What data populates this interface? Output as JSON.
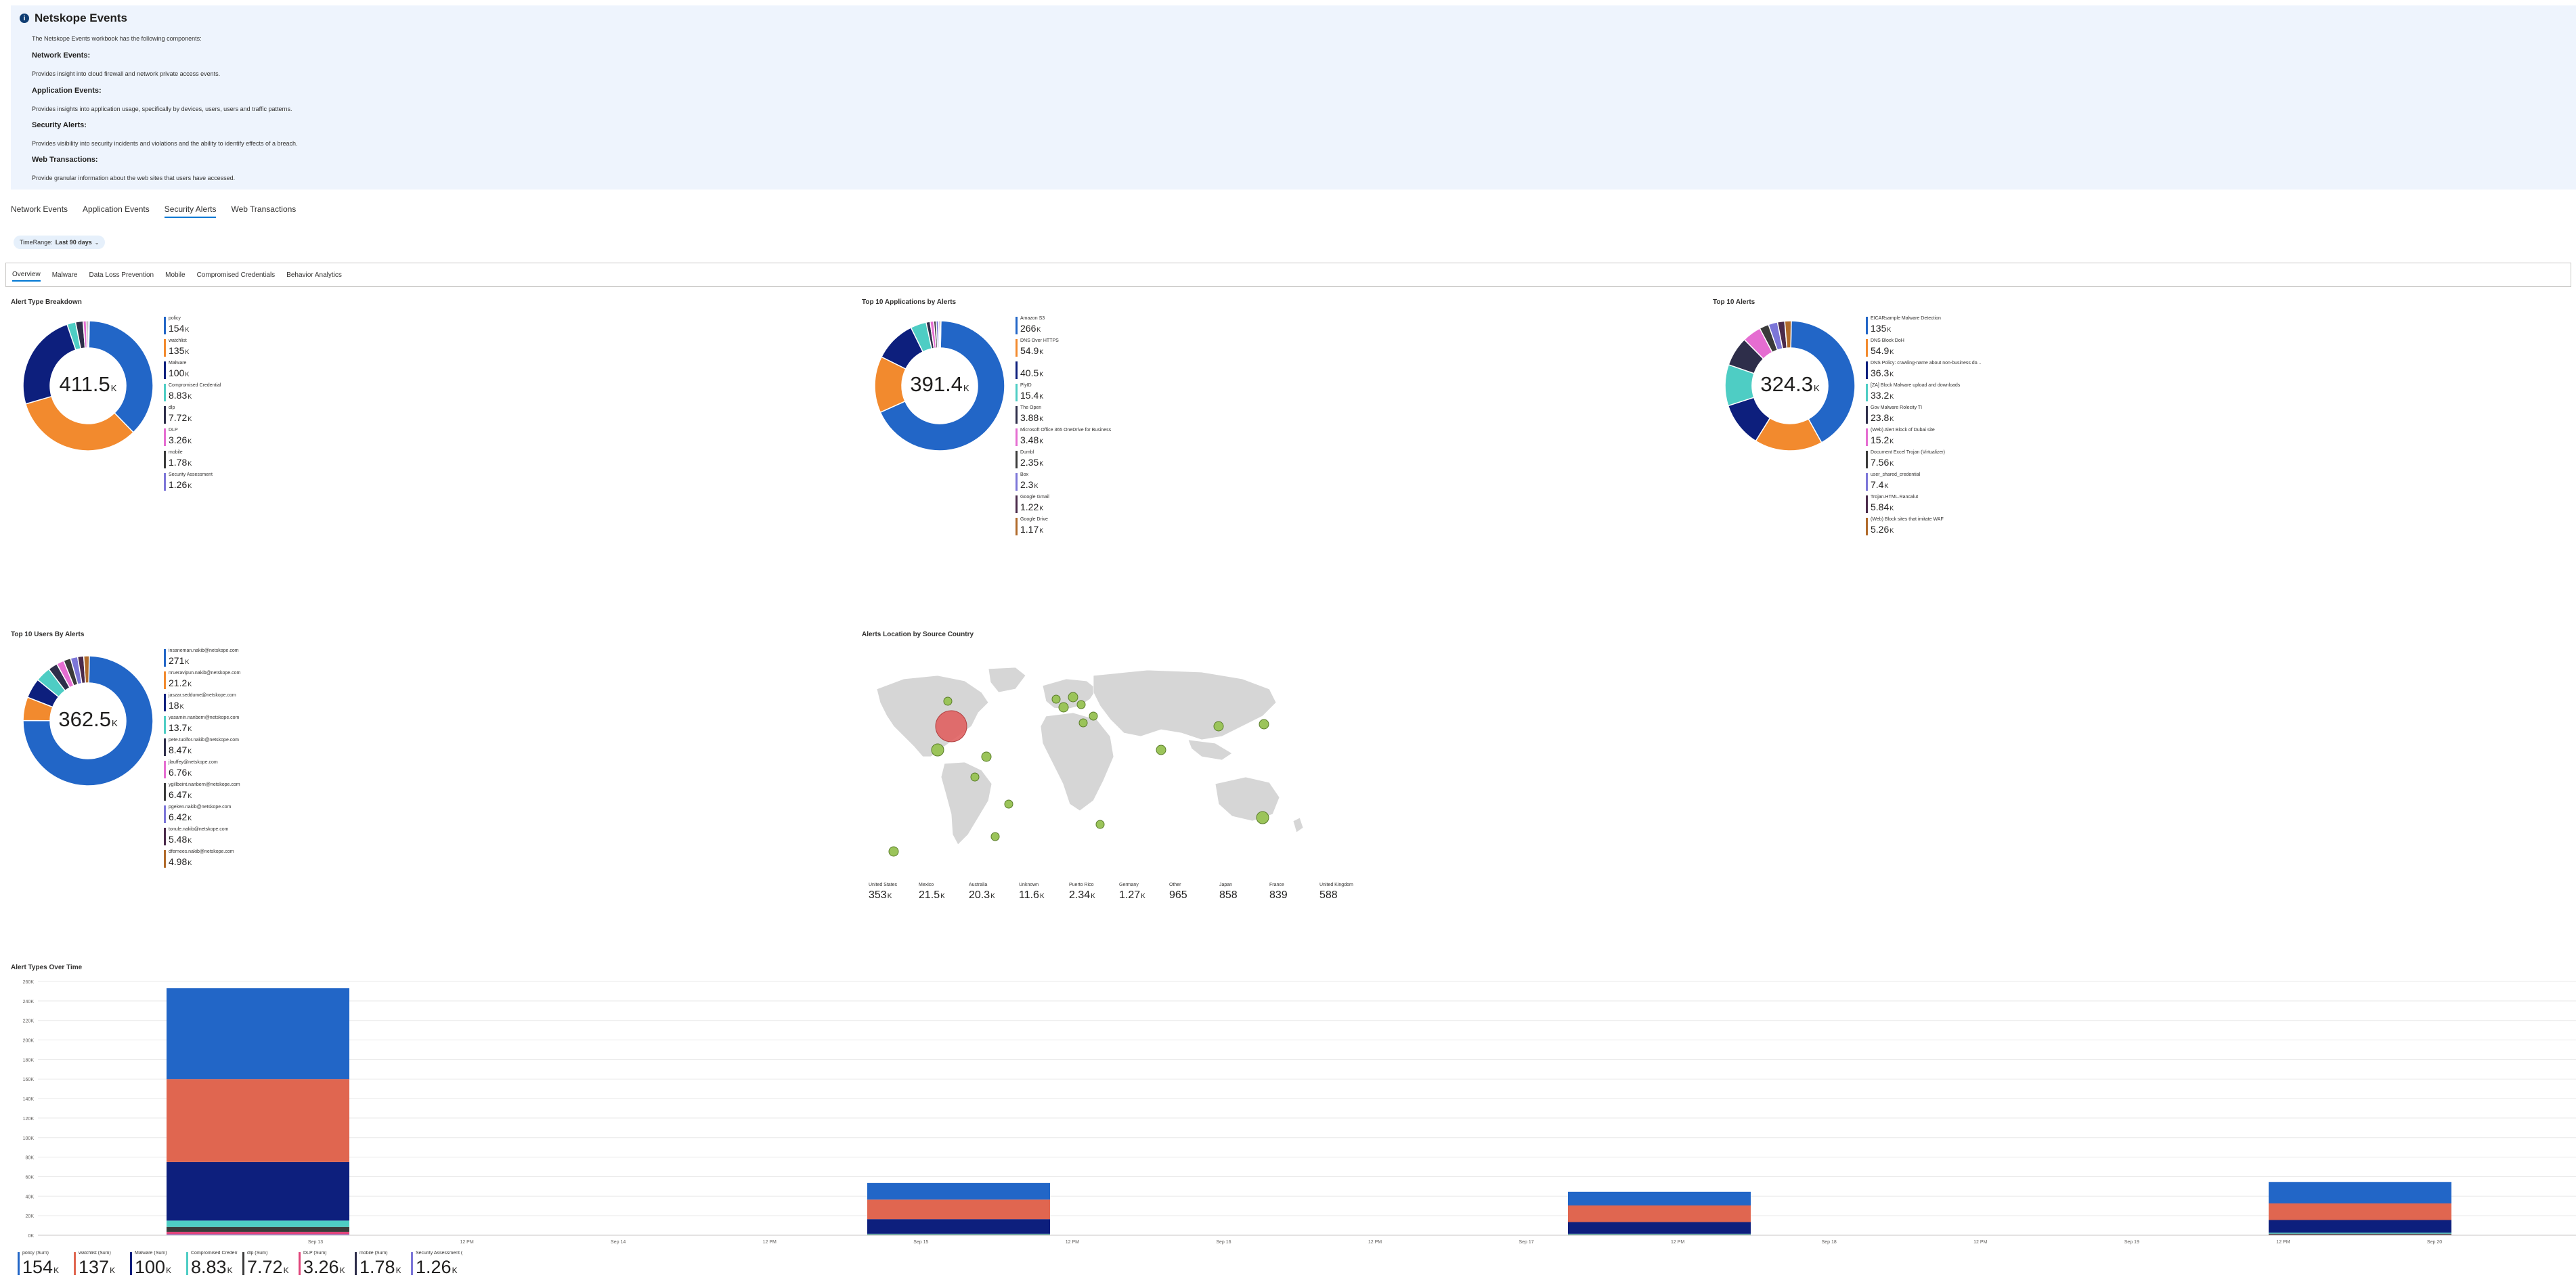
{
  "info": {
    "title": "Netskope Events",
    "intro": "The Netskope Events workbook has the following components:",
    "sections": [
      {
        "heading": "Network Events:",
        "text": "Provides insight into cloud firewall and network private access events."
      },
      {
        "heading": "Application Events:",
        "text": "Provides insights into application usage, specifically by devices, users, users and traffic patterns."
      },
      {
        "heading": "Security Alerts:",
        "text": "Provides visibility into security incidents and violations and the ability to identify effects of a breach."
      },
      {
        "heading": "Web Transactions:",
        "text": "Provide granular information about the web sites that users have accessed."
      }
    ]
  },
  "tabs": [
    "Network Events",
    "Application Events",
    "Security Alerts",
    "Web Transactions"
  ],
  "active_tab": 2,
  "param": {
    "label": "TimeRange:",
    "value": "Last 90 days"
  },
  "subtabs": [
    "Overview",
    "Malware",
    "Data Loss Prevention",
    "Mobile",
    "Compromised Credentials",
    "Behavior Analytics"
  ],
  "active_subtab": 0,
  "colors": [
    "#2266c7",
    "#f28a2e",
    "#0d1f7d",
    "#4ecdc4",
    "#2e2e4a",
    "#e56dd1",
    "#3a3a3a",
    "#7c76d8",
    "#4a2a4a",
    "#b06a2a"
  ],
  "panels": {
    "alert_type": {
      "title": "Alert Type Breakdown",
      "total": "411.5",
      "unit": "K",
      "items": [
        {
          "label": "policy",
          "value": "154",
          "unit": "K",
          "num": 154
        },
        {
          "label": "watchlist",
          "value": "135",
          "unit": "K",
          "num": 135
        },
        {
          "label": "Malware",
          "value": "100",
          "unit": "K",
          "num": 100
        },
        {
          "label": "Compromised Credential",
          "value": "8.83",
          "unit": "K",
          "num": 8.83
        },
        {
          "label": "dlp",
          "value": "7.72",
          "unit": "K",
          "num": 7.72
        },
        {
          "label": "DLP",
          "value": "3.26",
          "unit": "K",
          "num": 3.26
        },
        {
          "label": "mobile",
          "value": "1.78",
          "unit": "K",
          "num": 1.78
        },
        {
          "label": "Security Assessment",
          "value": "1.26",
          "unit": "K",
          "num": 1.26
        }
      ]
    },
    "top_apps": {
      "title": "Top 10 Applications by Alerts",
      "total": "391.4",
      "unit": "K",
      "items": [
        {
          "label": "Amazon S3",
          "value": "266",
          "unit": "K",
          "num": 266
        },
        {
          "label": "DNS Over HTTPS",
          "value": "54.9",
          "unit": "K",
          "num": 54.9
        },
        {
          "label": "",
          "value": "40.5",
          "unit": "K",
          "num": 40.5
        },
        {
          "label": "PlyID",
          "value": "15.4",
          "unit": "K",
          "num": 15.4
        },
        {
          "label": "The Open",
          "value": "3.88",
          "unit": "K",
          "num": 3.88
        },
        {
          "label": "Microsoft Office 365 OneDrive for Business",
          "value": "3.48",
          "unit": "K",
          "num": 3.48
        },
        {
          "label": "Dumbl",
          "value": "2.35",
          "unit": "K",
          "num": 2.35
        },
        {
          "label": "Box",
          "value": "2.3",
          "unit": "K",
          "num": 2.3
        },
        {
          "label": "Google Gmail",
          "value": "1.22",
          "unit": "K",
          "num": 1.22
        },
        {
          "label": "Google Drive",
          "value": "1.17",
          "unit": "K",
          "num": 1.17
        }
      ]
    },
    "top_alerts": {
      "title": "Top 10 Alerts",
      "total": "324.3",
      "unit": "K",
      "items": [
        {
          "label": "EICARsample Malware Detection",
          "value": "135",
          "unit": "K",
          "num": 135
        },
        {
          "label": "DNS Block DoH",
          "value": "54.9",
          "unit": "K",
          "num": 54.9
        },
        {
          "label": "DNS Policy: crawling-name about non-business do...",
          "value": "36.3",
          "unit": "K",
          "num": 36.3
        },
        {
          "label": "[ZA] Block Malware upload and downloads",
          "value": "33.2",
          "unit": "K",
          "num": 33.2
        },
        {
          "label": "Gov Malware Rolecity TI",
          "value": "23.8",
          "unit": "K",
          "num": 23.8
        },
        {
          "label": "(Web) Alert Block of Dubai site",
          "value": "15.2",
          "unit": "K",
          "num": 15.2
        },
        {
          "label": "Document Excel Trojan (Virtualizer)",
          "value": "7.56",
          "unit": "K",
          "num": 7.56
        },
        {
          "label": "user_shared_credential",
          "value": "7.4",
          "unit": "K",
          "num": 7.4
        },
        {
          "label": "Trojan.HTML.Rancalut",
          "value": "5.84",
          "unit": "K",
          "num": 5.84
        },
        {
          "label": "(Web) Block sites that imitate WAF",
          "value": "5.26",
          "unit": "K",
          "num": 5.26
        }
      ]
    },
    "top_users": {
      "title": "Top 10 Users By Alerts",
      "total": "362.5",
      "unit": "K",
      "items": [
        {
          "label": "insaneman.nakib@netskope.com",
          "value": "271",
          "unit": "K",
          "num": 271
        },
        {
          "label": "nrueravipun.nakib@netskope.com",
          "value": "21.2",
          "unit": "K",
          "num": 21.2
        },
        {
          "label": "jaszar.seddume@netskope.com",
          "value": "18",
          "unit": "K",
          "num": 18
        },
        {
          "label": "yasamin.nanbern@netskope.com",
          "value": "13.7",
          "unit": "K",
          "num": 13.7
        },
        {
          "label": "pete.tuolfor.nakib@netskope.com",
          "value": "8.47",
          "unit": "K",
          "num": 8.47
        },
        {
          "label": "jlauffey@netskope.com",
          "value": "6.76",
          "unit": "K",
          "num": 6.76
        },
        {
          "label": "ygillbeint.nanbern@netskope.com",
          "value": "6.47",
          "unit": "K",
          "num": 6.47
        },
        {
          "label": "pgeken.nakib@netskope.com",
          "value": "6.42",
          "unit": "K",
          "num": 6.42
        },
        {
          "label": "tonule.nakib@netskope.com",
          "value": "5.48",
          "unit": "K",
          "num": 5.48
        },
        {
          "label": "dfernees.nakib@netskope.com",
          "value": "4.98",
          "unit": "K",
          "num": 4.98
        }
      ]
    },
    "map": {
      "title": "Alerts Location by Source Country",
      "countries": [
        {
          "label": "United States",
          "value": "353",
          "unit": "K"
        },
        {
          "label": "Mexico",
          "value": "21.5",
          "unit": "K"
        },
        {
          "label": "Australia",
          "value": "20.3",
          "unit": "K"
        },
        {
          "label": "Unknown",
          "value": "11.6",
          "unit": "K"
        },
        {
          "label": "Puerto Rico",
          "value": "2.34",
          "unit": "K"
        },
        {
          "label": "Germany",
          "value": "1.27",
          "unit": "K"
        },
        {
          "label": "Other",
          "value": "965",
          "unit": ""
        },
        {
          "label": "Japan",
          "value": "858",
          "unit": ""
        },
        {
          "label": "France",
          "value": "839",
          "unit": ""
        },
        {
          "label": "United Kingdom",
          "value": "588",
          "unit": ""
        }
      ]
    },
    "over_time": {
      "title": "Alert Types Over Time",
      "legend": [
        {
          "label": "policy (Sum)",
          "value": "154",
          "unit": "K"
        },
        {
          "label": "watchlist (Sum)",
          "value": "137",
          "unit": "K"
        },
        {
          "label": "Malware (Sum)",
          "value": "100",
          "unit": "K"
        },
        {
          "label": "Compromised Credential...",
          "value": "8.83",
          "unit": "K"
        },
        {
          "label": "dlp (Sum)",
          "value": "7.72",
          "unit": "K"
        },
        {
          "label": "DLP (Sum)",
          "value": "3.26",
          "unit": "K"
        },
        {
          "label": "mobile (Sum)",
          "value": "1.78",
          "unit": "K"
        },
        {
          "label": "Security Assessment (Sum)",
          "value": "1.26",
          "unit": "K"
        }
      ]
    }
  },
  "chart_data": {
    "type": "bar",
    "stacked": true,
    "title": "Alert Types Over Time",
    "y_ticks": [
      "0K",
      "20K",
      "40K",
      "60K",
      "80K",
      "100K",
      "120K",
      "140K",
      "160K",
      "180K",
      "200K",
      "220K",
      "240K",
      "260K"
    ],
    "ylim": [
      0,
      260
    ],
    "x_ticks": [
      "Sep 13",
      "12 PM",
      "Sep 14",
      "12 PM",
      "Sep 15",
      "12 PM",
      "Sep 16",
      "12 PM",
      "Sep 17",
      "12 PM",
      "Sep 18",
      "12 PM",
      "Sep 19",
      "12 PM",
      "Sep 20",
      "12 PM"
    ],
    "categories": [
      "Sep 13",
      "Sep 17",
      "Sep 19",
      "Sep 20"
    ],
    "series": [
      {
        "name": "mobile (Sum)",
        "values": [
          1.0,
          0.2,
          0.2,
          0.3
        ]
      },
      {
        "name": "DLP (Sum)",
        "values": [
          2.5,
          0.2,
          0.2,
          0.3
        ]
      },
      {
        "name": "dlp (Sum)",
        "values": [
          5.0,
          0.5,
          0.5,
          1.0
        ]
      },
      {
        "name": "Compromised Credential...",
        "values": [
          6.5,
          0.6,
          0.6,
          1.0
        ]
      },
      {
        "name": "Malware (Sum)",
        "values": [
          60,
          15,
          12,
          13
        ]
      },
      {
        "name": "watchlist (Sum)",
        "values": [
          85,
          20,
          17,
          17
        ]
      },
      {
        "name": "policy (Sum)",
        "values": [
          93,
          17,
          14,
          22
        ]
      }
    ],
    "series_colors": [
      "#7c76d8",
      "#e0447a",
      "#3a3a3a",
      "#4ecdc4",
      "#0d1f7d",
      "#e06650",
      "#2266c7"
    ],
    "grid": true
  }
}
